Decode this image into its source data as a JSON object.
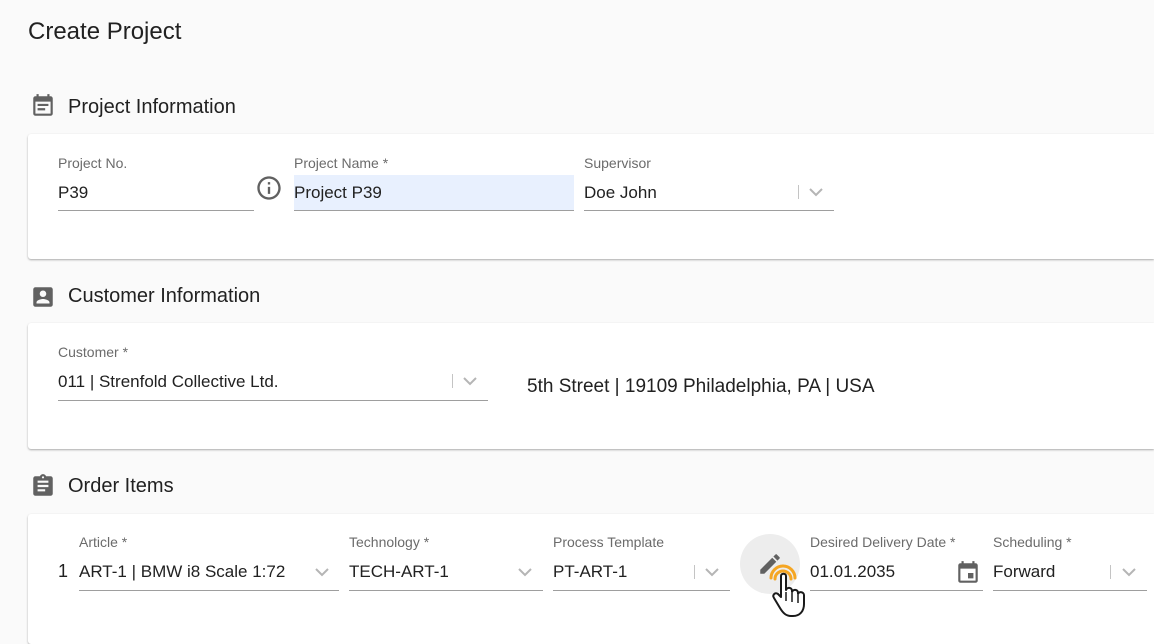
{
  "page": {
    "title": "Create Project"
  },
  "project_info": {
    "section_title": "Project Information",
    "project_no": {
      "label": "Project No.",
      "value": "P39"
    },
    "project_name": {
      "label": "Project Name *",
      "value": "Project P39"
    },
    "supervisor": {
      "label": "Supervisor",
      "value": "Doe John"
    }
  },
  "customer_info": {
    "section_title": "Customer Information",
    "customer": {
      "label": "Customer *",
      "value": "011 | Strenfold Collective Ltd."
    },
    "address": "5th Street | 19109 Philadelphia, PA | USA"
  },
  "order_items": {
    "section_title": "Order Items",
    "rows": [
      {
        "number": "1",
        "article": {
          "label": "Article *",
          "value": "ART-1 | BMW i8 Scale 1:72"
        },
        "technology": {
          "label": "Technology *",
          "value": "TECH-ART-1"
        },
        "process_template": {
          "label": "Process Template",
          "value": "PT-ART-1"
        },
        "delivery_date": {
          "label": "Desired Delivery Date *",
          "value": "01.01.2035"
        },
        "scheduling": {
          "label": "Scheduling *",
          "value": "Forward"
        }
      }
    ]
  },
  "colors": {
    "accent_highlight": "#e8f0fe",
    "cursor_accent": "#f5a623",
    "icon_gray": "#616161"
  },
  "icons": {
    "project_section": "event-note-icon",
    "customer_section": "account-box-icon",
    "order_section": "assignment-icon",
    "info": "info-outline-icon",
    "dropdown": "chevron-down-icon",
    "edit": "pencil-icon",
    "calendar": "calendar-icon",
    "cursor": "hand-pointer-icon"
  }
}
